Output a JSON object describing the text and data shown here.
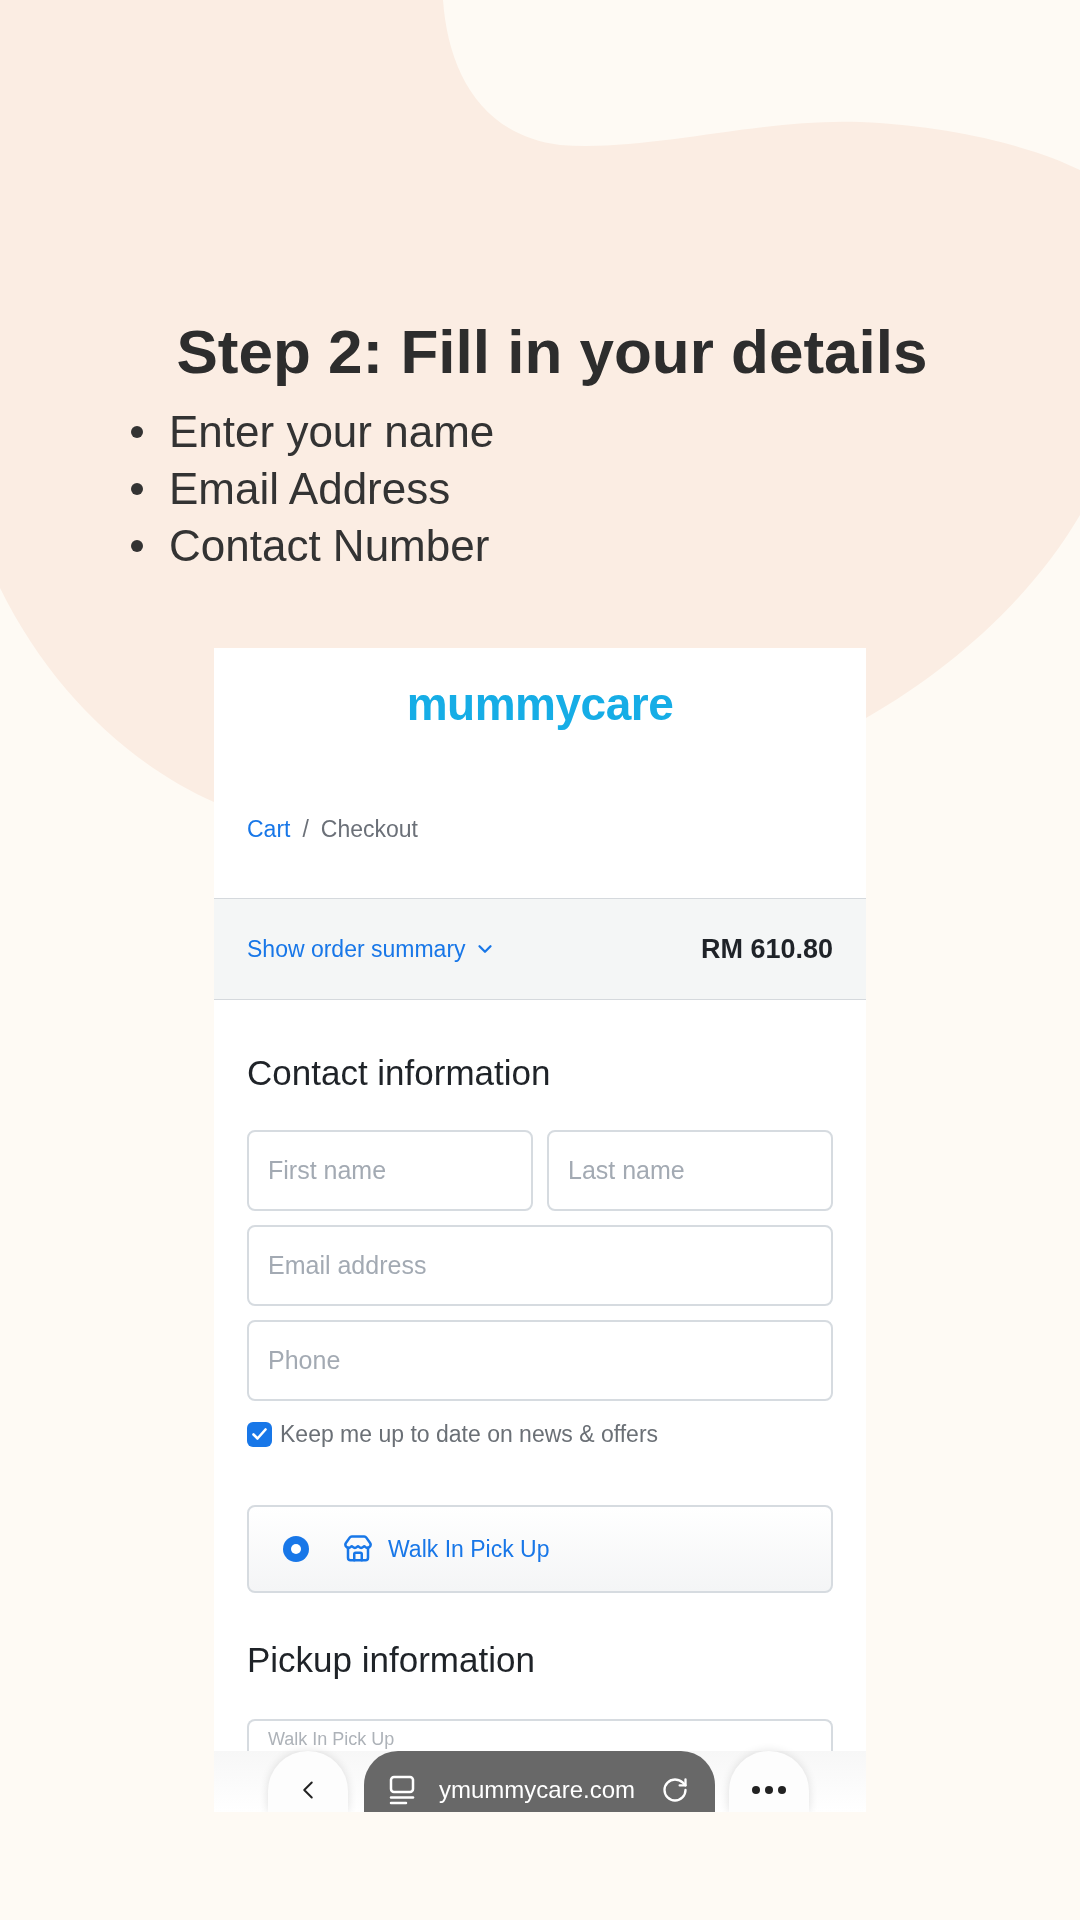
{
  "heading": "Step 2: Fill in your details",
  "steps": [
    "Enter your name",
    "Email Address",
    "Contact Number"
  ],
  "phone_screen": {
    "logo": "mummycare",
    "breadcrumb": [
      {
        "label": "Cart",
        "kind": "link"
      },
      {
        "label": "/",
        "kind": "separator"
      },
      {
        "label": "Checkout",
        "kind": "current"
      }
    ],
    "order_summary": {
      "toggle": "Show order summary",
      "expanded": false,
      "total": "RM 610.80"
    },
    "contact": {
      "title": "Contact information",
      "field_rows": [
        {
          "fields": [
            {
              "placeholder": "First name"
            },
            {
              "placeholder": "Last name"
            }
          ]
        },
        {
          "fields": [
            {
              "placeholder": "Email address"
            }
          ]
        },
        {
          "fields": [
            {
              "placeholder": "Phone"
            }
          ]
        }
      ],
      "newsletter": {
        "label": "Keep me up to date on news & offers",
        "checked": true
      }
    },
    "delivery_options": [
      {
        "label": "Walk In Pick Up",
        "selected": true
      }
    ],
    "pickup": {
      "title": "Pickup information",
      "field_label": "Walk In Pick Up"
    },
    "browser_bar": {
      "url": "ymummycare.com"
    }
  }
}
